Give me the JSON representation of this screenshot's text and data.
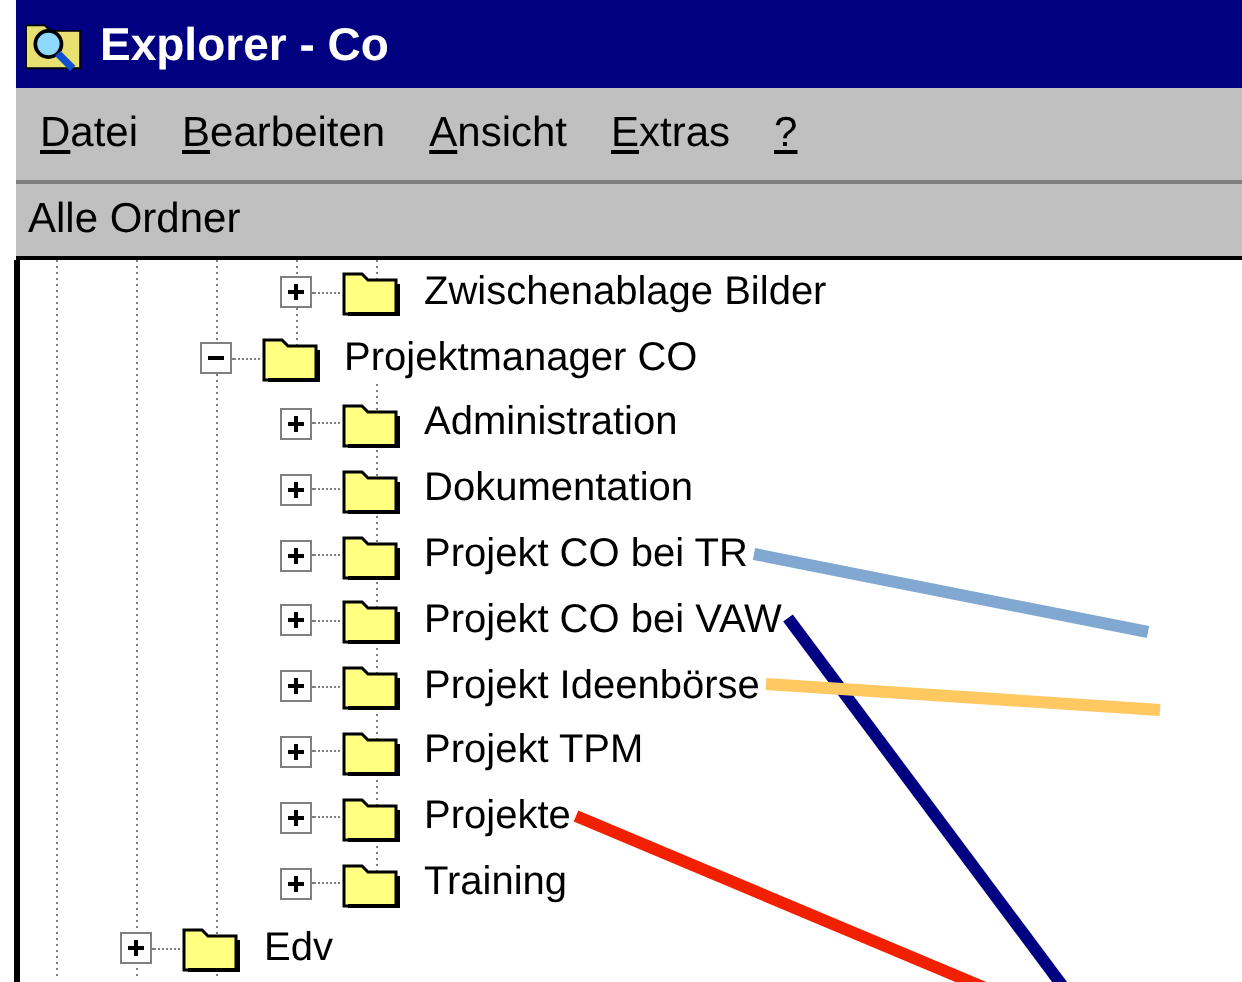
{
  "window": {
    "title": "Explorer - Co"
  },
  "menu": [
    "Datei",
    "Bearbeiten",
    "Ansicht",
    "Extras",
    "?"
  ],
  "pane_header": "Alle Ordner",
  "tree": [
    {
      "children": [
        {
          "children": [
            {
              "label": "Zwischenablage Bilder",
              "expanded": false
            }
          ]
        },
        {
          "label": "Projektmanager CO",
          "expanded": true,
          "children": [
            {
              "label": "Administration",
              "expanded": false
            },
            {
              "label": "Dokumentation",
              "expanded": false
            },
            {
              "label": "Projekt CO bei TR",
              "expanded": false,
              "pointer": {
                "color": "#80a8d0"
              }
            },
            {
              "label": "Projekt CO bei VAW",
              "expanded": false,
              "pointer": {
                "color": "#000080"
              }
            },
            {
              "label": "Projekt Ideenbörse",
              "expanded": false,
              "pointer": {
                "color": "#ffc860"
              }
            },
            {
              "label": "Projekt TPM",
              "expanded": false
            },
            {
              "label": "Projekte",
              "expanded": false,
              "pointer": {
                "color": "#f02000"
              }
            },
            {
              "label": "Training",
              "expanded": false
            }
          ]
        }
      ]
    },
    {
      "label": "Edv",
      "expanded": false
    }
  ]
}
